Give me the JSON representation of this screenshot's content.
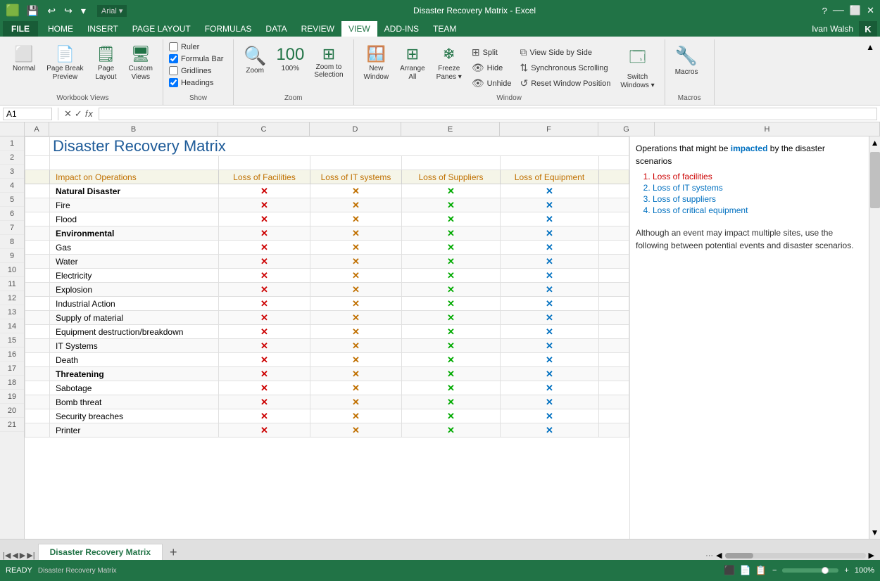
{
  "titleBar": {
    "title": "Disaster Recovery Matrix - Excel",
    "quickAccess": [
      "💾",
      "↩",
      "↪"
    ],
    "font": "Arial",
    "windowButtons": [
      "?",
      "—",
      "⬜",
      "✕"
    ]
  },
  "menuBar": {
    "fileLabel": "FILE",
    "items": [
      "HOME",
      "INSERT",
      "PAGE LAYOUT",
      "FORMULAS",
      "DATA",
      "REVIEW",
      "VIEW",
      "ADD-INS",
      "TEAM"
    ],
    "activeItem": "VIEW",
    "userName": "Ivan Walsh",
    "userInitial": "K"
  },
  "ribbon": {
    "workbookViewsLabel": "Workbook Views",
    "showLabel": "Show",
    "zoomLabel": "Zoom",
    "windowLabel": "Window",
    "macrosLabel": "Macros",
    "buttons": {
      "normal": "Normal",
      "pageBreak": "Page Break Preview",
      "pageLayout": "Page Layout",
      "customViews": "Custom Views",
      "zoom": "Zoom",
      "zoomPercent": "100%",
      "zoomToSelection": "Zoom to Selection",
      "newWindow": "New Window",
      "arrangeAll": "Arrange All",
      "freezePanes": "Freeze Panes",
      "split": "Split",
      "hide": "Hide",
      "unhide": "Unhide",
      "viewSideBySide": "View Side by Side",
      "syncScrolling": "Synchronous Scrolling",
      "resetWindowPosition": "Reset Window Position",
      "switchWindows": "Switch Windows",
      "macros": "Macros"
    },
    "checkboxes": {
      "ruler": "Ruler",
      "gridlines": "Gridlines",
      "formulaBar": "Formula Bar",
      "headings": "Headings"
    },
    "rulerChecked": false,
    "gridlinesChecked": false,
    "formulaBarChecked": true,
    "headingsChecked": true
  },
  "formulaBar": {
    "cellRef": "A1",
    "value": ""
  },
  "columnHeaders": [
    "A",
    "B",
    "C",
    "D",
    "E",
    "F",
    "G",
    "H"
  ],
  "spreadsheet": {
    "title": "Disaster Recovery Matrix",
    "tableHeaders": [
      "Impact on Operations",
      "Loss of Facilities",
      "Loss of IT systems",
      "Loss of Suppliers",
      "Loss of Equipment"
    ],
    "rows": [
      {
        "num": 1,
        "cells": [],
        "isTitle": true
      },
      {
        "num": 2,
        "cells": [],
        "isTitle": false
      },
      {
        "num": 3,
        "label": "Impact on Operations",
        "isBold": false,
        "isHeader": true
      },
      {
        "num": 4,
        "label": "Natural Disaster",
        "isBold": true
      },
      {
        "num": 5,
        "label": "Fire",
        "isBold": false
      },
      {
        "num": 6,
        "label": "Flood",
        "isBold": false
      },
      {
        "num": 7,
        "label": "Environmental",
        "isBold": true
      },
      {
        "num": 8,
        "label": "Gas",
        "isBold": false
      },
      {
        "num": 9,
        "label": "Water",
        "isBold": false
      },
      {
        "num": 10,
        "label": "Electricity",
        "isBold": false
      },
      {
        "num": 11,
        "label": "Explosion",
        "isBold": false
      },
      {
        "num": 12,
        "label": "Industrial Action",
        "isBold": false
      },
      {
        "num": 13,
        "label": "Supply of material",
        "isBold": false
      },
      {
        "num": 14,
        "label": "Equipment destruction/breakdown",
        "isBold": false
      },
      {
        "num": 15,
        "label": "IT Systems",
        "isBold": false
      },
      {
        "num": 16,
        "label": "Death",
        "isBold": false
      },
      {
        "num": 17,
        "label": "Threatening",
        "isBold": true
      },
      {
        "num": 18,
        "label": "Sabotage",
        "isBold": false
      },
      {
        "num": 19,
        "label": "Bomb threat",
        "isBold": false
      },
      {
        "num": 20,
        "label": "Security breaches",
        "isBold": false
      },
      {
        "num": 21,
        "label": "Printer",
        "isBold": false
      }
    ],
    "rowNums": [
      1,
      2,
      3,
      4,
      5,
      6,
      7,
      8,
      9,
      10,
      11,
      12,
      13,
      14,
      15,
      16,
      17,
      18,
      19,
      20,
      21
    ]
  },
  "sidePanel": {
    "introText": "Operations that might be impacted by the disaster scenarios",
    "highlightedWord": "impacted",
    "listItems": [
      {
        "num": 1,
        "text": "Loss of facilities",
        "color": "red"
      },
      {
        "num": 2,
        "text": "Loss of IT systems",
        "color": "blue"
      },
      {
        "num": 3,
        "text": "Loss of suppliers",
        "color": "blue"
      },
      {
        "num": 4,
        "text": "Loss of critical equipment",
        "color": "blue"
      }
    ],
    "footerNote": "Although an event may impact multiple sites, use the following between potential events and disaster scenarios."
  },
  "sheetTabs": {
    "tabs": [
      "Disaster Recovery Matrix"
    ],
    "addLabel": "+"
  },
  "statusBar": {
    "readyLabel": "READY",
    "zoomLevel": "100%"
  }
}
